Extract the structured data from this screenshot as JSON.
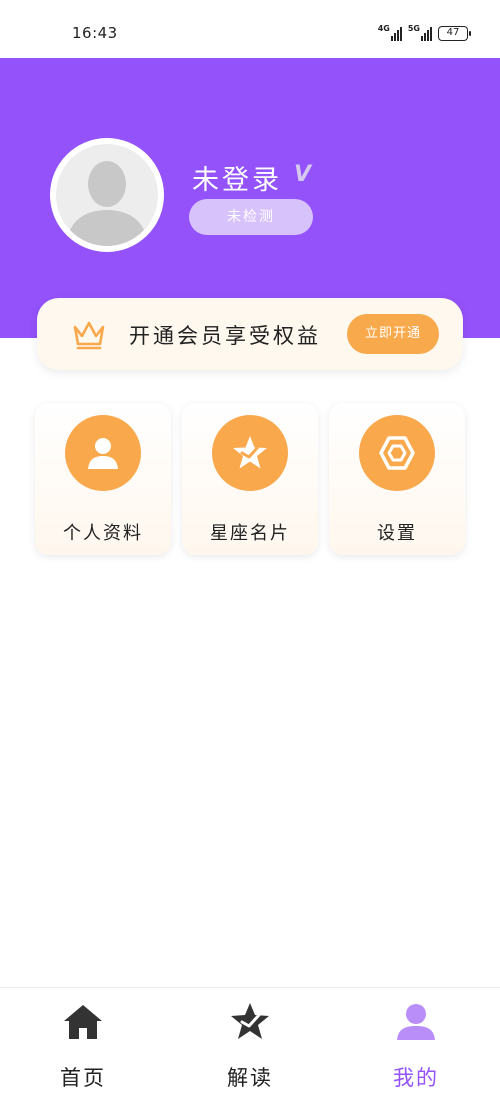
{
  "status_bar": {
    "time": "16:43",
    "network_1": "4G",
    "network_2": "5G",
    "battery": "47"
  },
  "profile": {
    "username": "未登录",
    "badge": "V",
    "status_pill": "未检测"
  },
  "vip": {
    "text": "开通会员享受权益",
    "button": "立即开通",
    "icon": "crown-icon"
  },
  "features": [
    {
      "label": "个人资料",
      "icon": "user-icon"
    },
    {
      "label": "星座名片",
      "icon": "star-icon"
    },
    {
      "label": "设置",
      "icon": "hexagon-settings-icon"
    }
  ],
  "nav": [
    {
      "label": "首页",
      "icon": "home-icon",
      "active": false
    },
    {
      "label": "解读",
      "icon": "star-icon",
      "active": false
    },
    {
      "label": "我的",
      "icon": "user-icon",
      "active": true
    }
  ],
  "colors": {
    "brand_purple": "#9452fa",
    "accent_orange": "#f9a84b",
    "pill_light_purple": "#d8c2fc",
    "nav_inactive": "#333333"
  }
}
